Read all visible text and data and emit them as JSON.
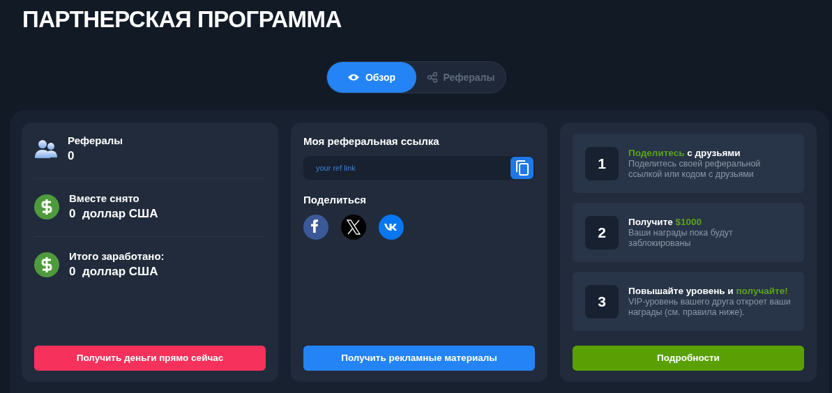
{
  "title": "ПАРТНЕРСКАЯ ПРОГРАММА",
  "tabs": [
    {
      "label": "Обзор",
      "kind": "eye",
      "selected": true
    },
    {
      "label": "Рефералы",
      "kind": "share",
      "selected": false
    }
  ],
  "stats": [
    {
      "kind": "users",
      "label": "Рефералы",
      "value": "0"
    },
    {
      "kind": "dollar",
      "label": "Вместе снято",
      "value": "0  доллар США"
    },
    {
      "kind": "dollar",
      "label": "Итого заработано:",
      "value": "0  доллар США"
    }
  ],
  "withdraw_button": "Получить деньги прямо сейчас",
  "ref_link": {
    "heading": "Моя реферальная ссылка",
    "value": "your ref link"
  },
  "share": {
    "heading": "Поделиться",
    "networks": [
      {
        "kind": "facebook"
      },
      {
        "kind": "x"
      },
      {
        "kind": "vk"
      }
    ]
  },
  "materials_button": "Получить рекламные материалы",
  "steps": [
    {
      "number": "1",
      "title": [
        {
          "text": "Поделитесь",
          "accent": true
        },
        {
          "text": " с друзьями",
          "accent": false
        }
      ],
      "text": "Поделитесь своей реферальной ссылкой или кодом с друзьями"
    },
    {
      "number": "2",
      "title": [
        {
          "text": "Получите ",
          "accent": false
        },
        {
          "text": "$1000",
          "accent": true
        }
      ],
      "text": "Ваши награды пока будут заблокированы"
    },
    {
      "number": "3",
      "title": [
        {
          "text": "Повышайте уровень и ",
          "accent": false
        },
        {
          "text": "получайте!",
          "accent": true
        }
      ],
      "text": "VIP-уровень вашего друга откроет ваши награды (см. правила ниже)."
    }
  ],
  "details_button": "Подробности"
}
